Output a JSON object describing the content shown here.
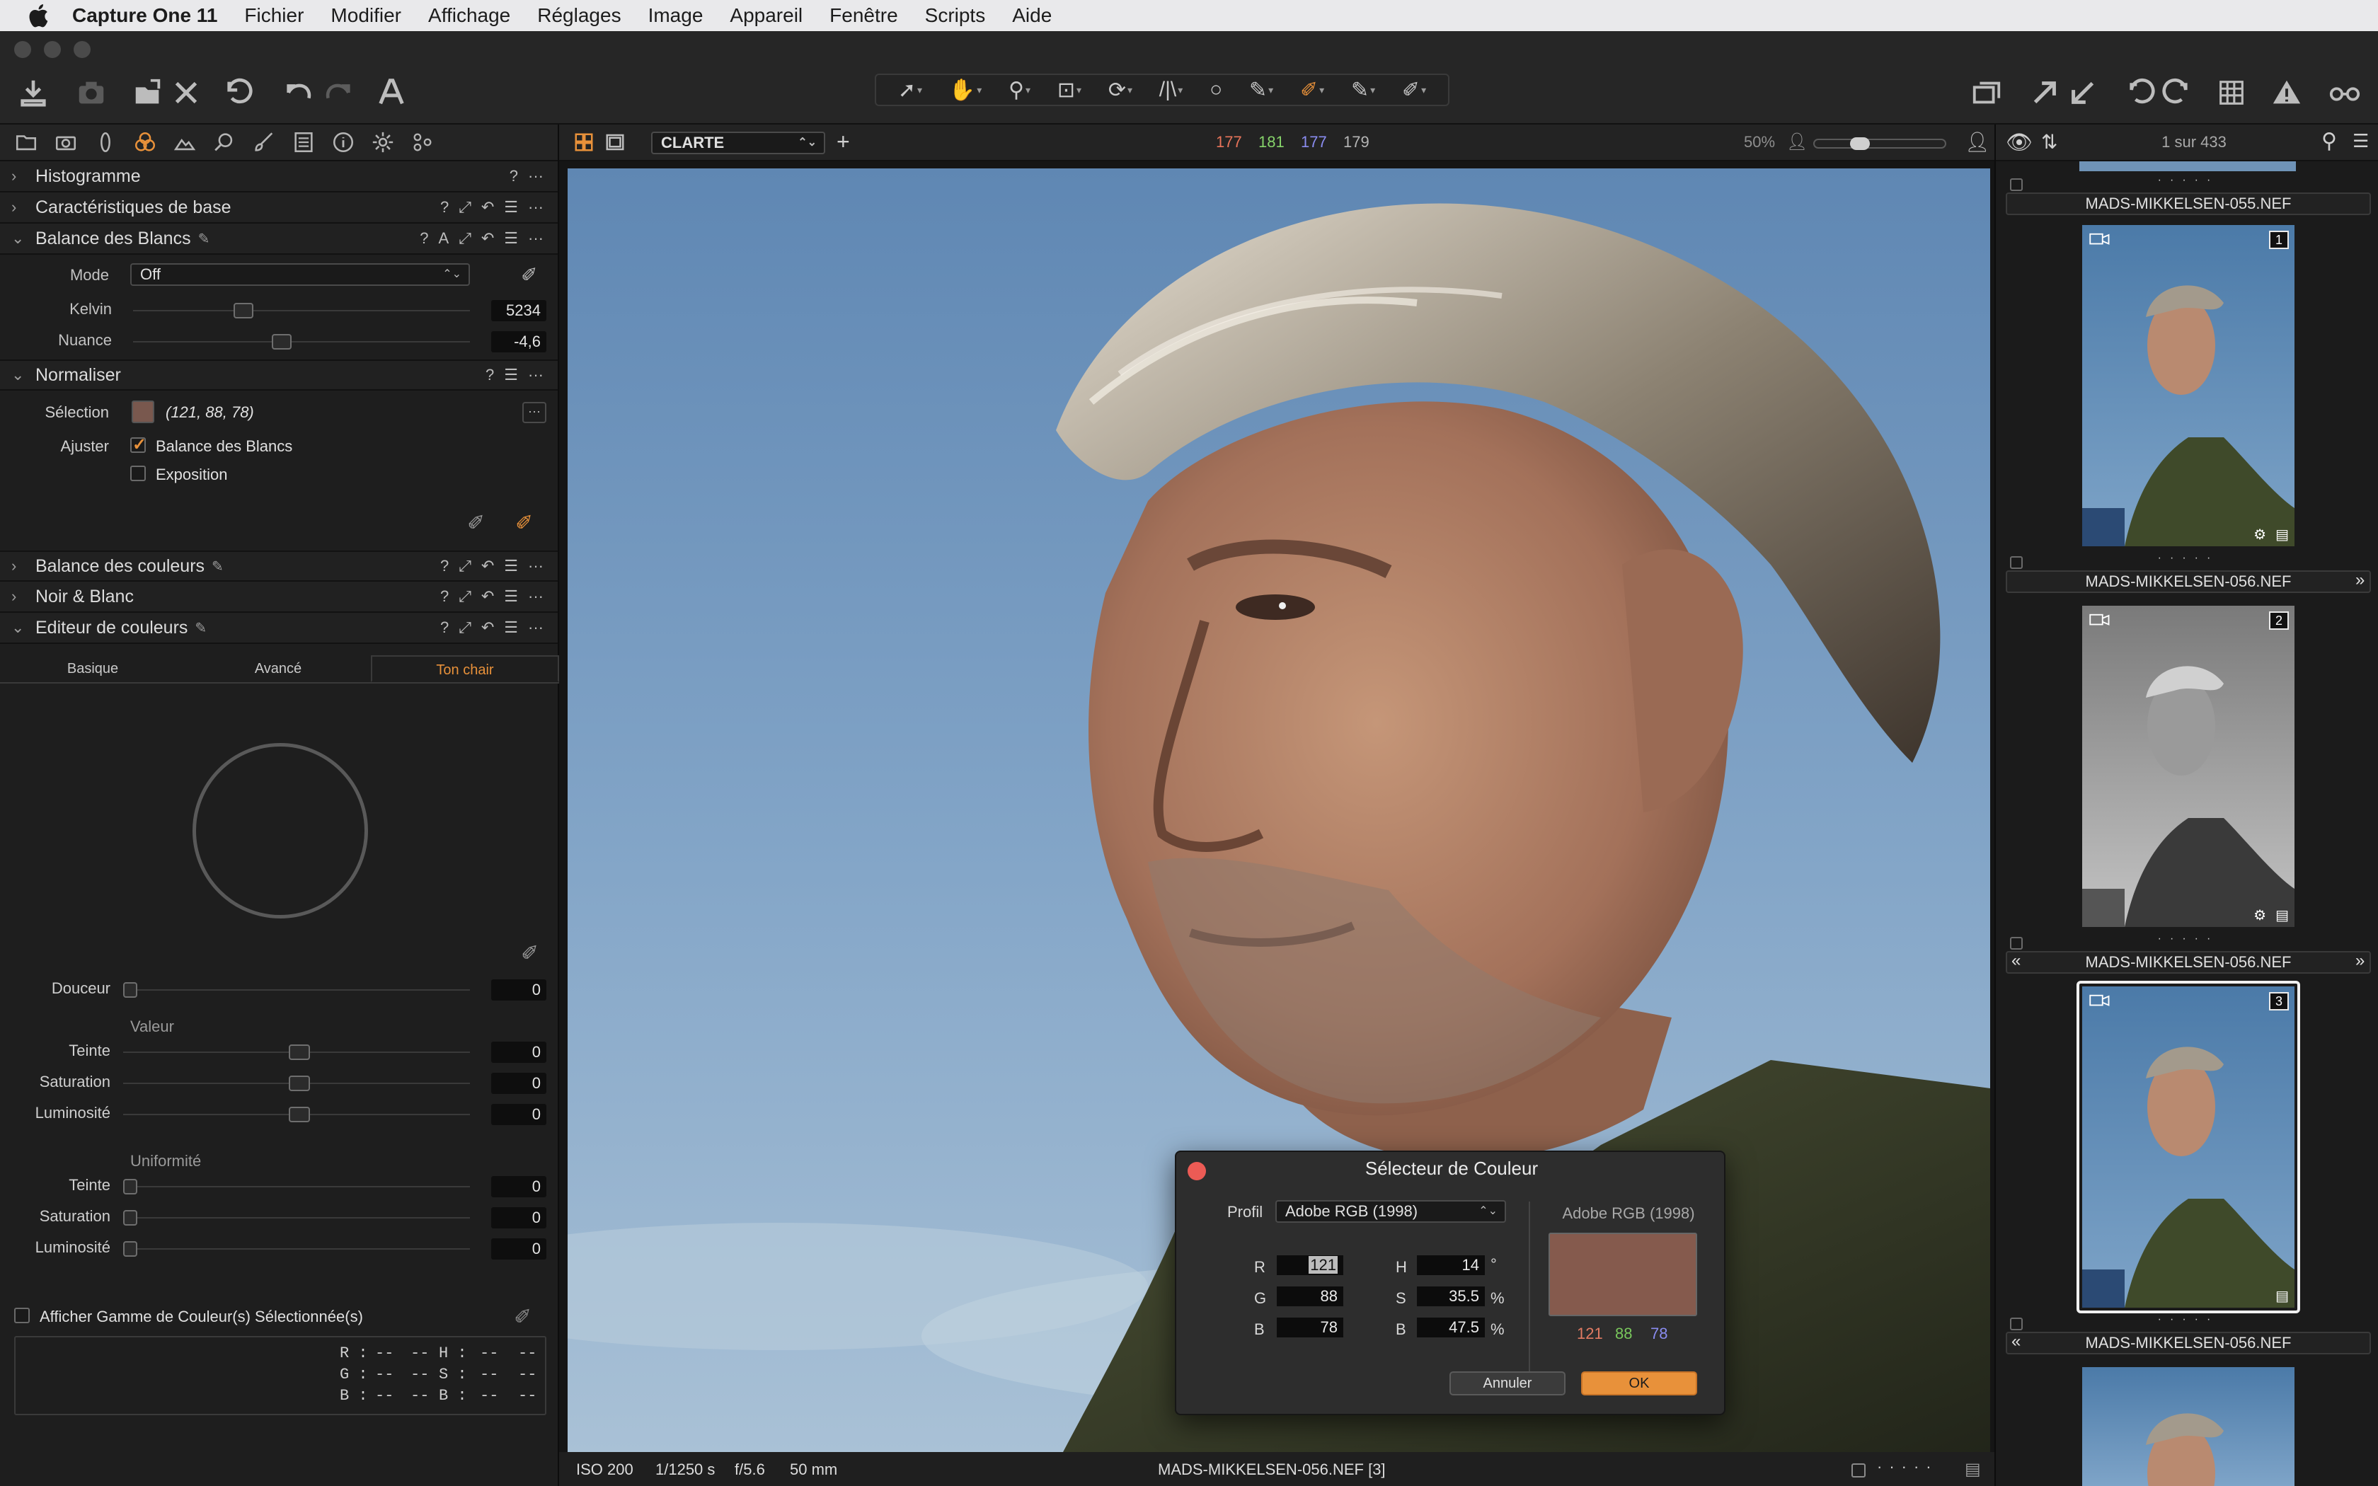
{
  "menubar": {
    "app_name": "Capture One 11",
    "items": [
      "Fichier",
      "Modifier",
      "Affichage",
      "Réglages",
      "Image",
      "Appareil",
      "Fenêtre",
      "Scripts",
      "Aide"
    ]
  },
  "left_panel": {
    "sections": {
      "histogram": "Histogramme",
      "basic": "Caractéristiques de base",
      "wb": "Balance des Blancs",
      "normalize": "Normaliser",
      "color_balance": "Balance des couleurs",
      "bw": "Noir & Blanc",
      "color_editor": "Editeur de couleurs"
    },
    "wb": {
      "mode_label": "Mode",
      "mode_value": "Off",
      "kelvin_label": "Kelvin",
      "kelvin_value": "5234",
      "tint_label": "Nuance",
      "tint_value": "-4,6"
    },
    "normalize": {
      "selection_label": "Sélection",
      "selection_value": "(121, 88, 78)",
      "adjust_label": "Ajuster",
      "wb_check": "Balance des Blancs",
      "exposure_check": "Exposition",
      "swatch_color": "#79584e"
    },
    "color_editor": {
      "tabs": [
        "Basique",
        "Avancé",
        "Ton chair"
      ],
      "active_tab": "Ton chair",
      "smoothness_label": "Douceur",
      "smoothness_value": "0",
      "value_header": "Valeur",
      "value_rows": [
        {
          "label": "Teinte",
          "value": "0"
        },
        {
          "label": "Saturation",
          "value": "0"
        },
        {
          "label": "Luminosité",
          "value": "0"
        }
      ],
      "uniformity_header": "Uniformité",
      "uniformity_rows": [
        {
          "label": "Teinte",
          "value": "0"
        },
        {
          "label": "Saturation",
          "value": "0"
        },
        {
          "label": "Luminosité",
          "value": "0"
        }
      ],
      "show_gamut_label": "Afficher Gamme de Couleur(s) Sélectionnée(s)",
      "readout": {
        "r": "R :",
        "g": "G :",
        "b": "B :",
        "h": "H :",
        "s": "S :",
        "b2": "B :",
        "dash": "--"
      }
    }
  },
  "viewer": {
    "style_select": "CLARTE",
    "readout": {
      "r": "177",
      "g": "181",
      "b": "177",
      "l": "179"
    },
    "readout_colors": {
      "r": "#e8745a",
      "g": "#86d36a",
      "b": "#8a8cf0",
      "l": "#b5b5b5"
    },
    "zoom": "50%",
    "status": {
      "iso": "ISO 200",
      "shutter": "1/1250 s",
      "aperture": "f/5.6",
      "focal": "50 mm",
      "filename": "MADS-MIKKELSEN-056.NEF [3]"
    }
  },
  "color_picker": {
    "title": "Sélecteur de Couleur",
    "profile_label": "Profil",
    "profile_value": "Adobe RGB (1998)",
    "preview_label": "Adobe RGB (1998)",
    "r_label": "R",
    "r_value": "121",
    "g_label": "G",
    "g_value": "88",
    "b_label": "B",
    "b_value": "78",
    "h_label": "H",
    "h_value": "14",
    "h_unit": "°",
    "s_label": "S",
    "s_value": "35.5",
    "s_unit": "%",
    "bb_label": "B",
    "bb_value": "47.5",
    "bb_unit": "%",
    "preview_color": "#855a4d",
    "preview_r": "121",
    "preview_g": "88",
    "preview_b": "78",
    "cancel": "Annuler",
    "ok": "OK",
    "accent": "#e8913a"
  },
  "browser": {
    "count": "1 sur 433",
    "items": [
      {
        "name": "MADS-MIKKELSEN-055.NEF",
        "badge": "",
        "variant": "partial"
      },
      {
        "name": "MADS-MIKKELSEN-056.NEF",
        "badge": "1",
        "variant": "color"
      },
      {
        "name": "MADS-MIKKELSEN-056.NEF",
        "badge": "2",
        "variant": "bw"
      },
      {
        "name": "MADS-MIKKELSEN-056.NEF",
        "badge": "3",
        "variant": "color-selected"
      },
      {
        "name": "MADS-MIKKELSEN-056.NEF",
        "badge": "",
        "variant": "partial-bottom"
      }
    ]
  }
}
